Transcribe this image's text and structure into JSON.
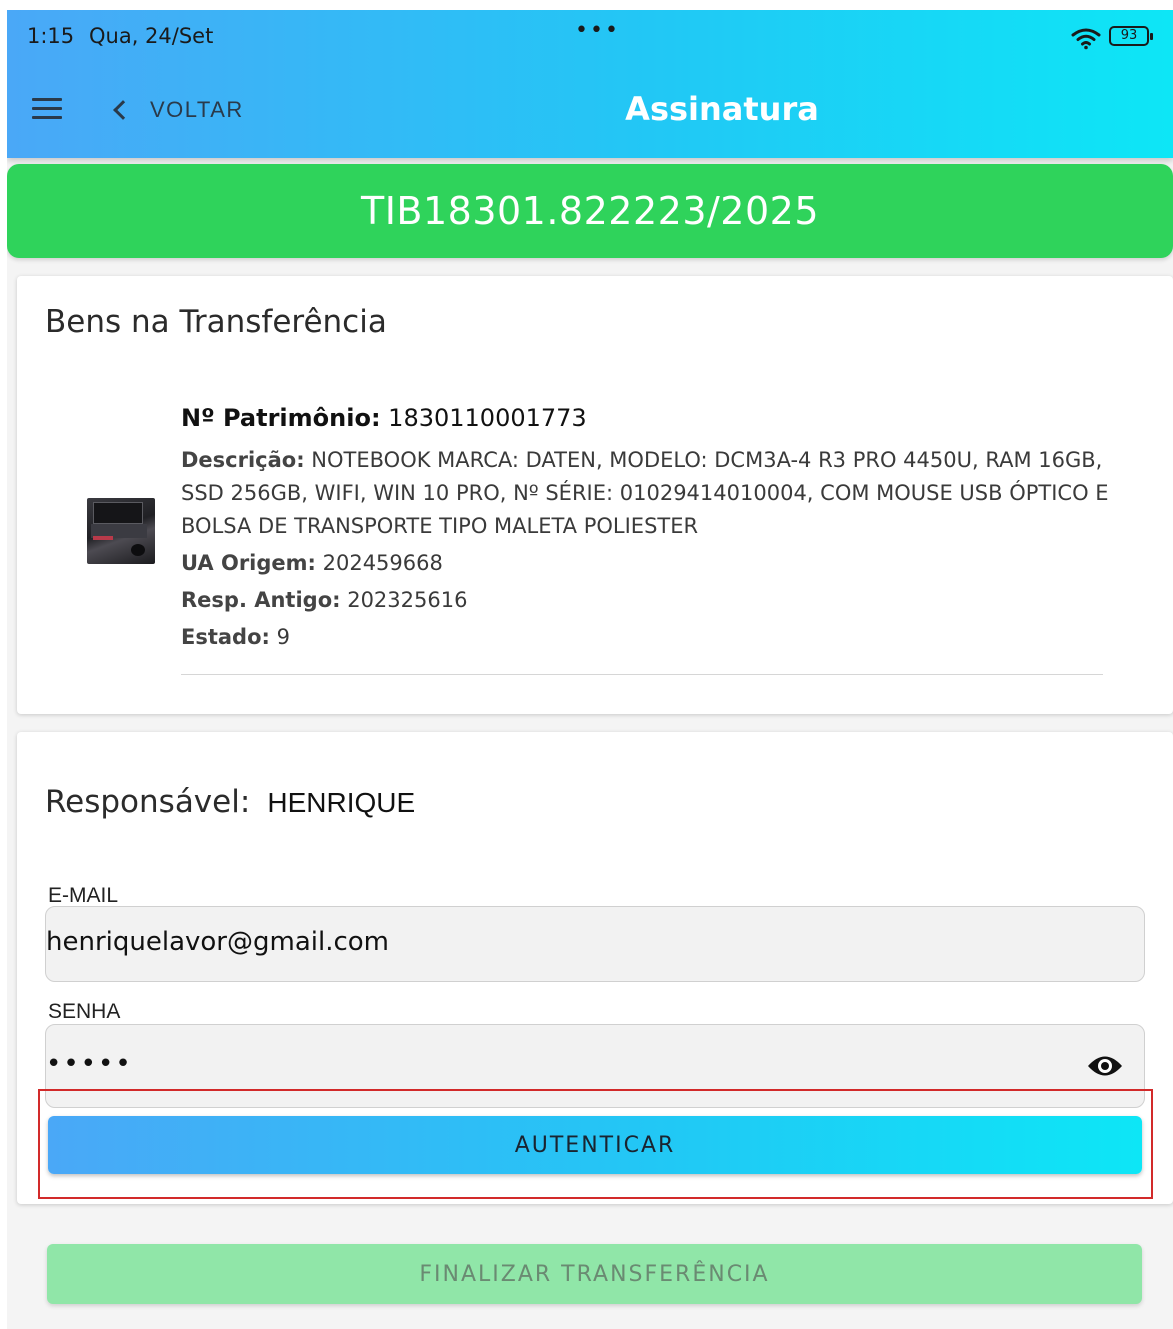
{
  "status_bar": {
    "time": "1:15",
    "date": "Qua, 24/Set",
    "dots": "•••",
    "battery": "93"
  },
  "header": {
    "back_label": "VOLTAR",
    "title": "Assinatura"
  },
  "banner": {
    "code": "TIB18301.822223/2025"
  },
  "items_card": {
    "title": "Bens na Transferência",
    "items": [
      {
        "patrimonio_label": "Nº Patrimônio:",
        "patrimonio_value": " 1830110001773",
        "descricao_label": "Descrição:",
        "descricao_value": " NOTEBOOK MARCA: DATEN, MODELO: DCM3A-4 R3 PRO 4450U, RAM 16GB, SSD 256GB, WIFI, WIN 10 PRO, Nº SÉRIE: 01029414010004, COM MOUSE USB ÓPTICO E BOLSA DE TRANSPORTE TIPO MALETA POLIESTER",
        "ua_label": "UA Origem:",
        "ua_value": " 202459668",
        "resp_label": "Resp. Antigo:",
        "resp_value": " 202325616",
        "estado_label": "Estado:",
        "estado_value": " 9"
      }
    ]
  },
  "auth_card": {
    "responsavel_label": "Responsável:",
    "responsavel_name": "HENRIQUE",
    "email_label": "E-MAIL",
    "email_value": "henriquelavor@gmail.com",
    "password_label": "SENHA",
    "password_value": "•••••",
    "auth_button": "AUTENTICAR"
  },
  "finalize_button": "FINALIZAR TRANSFERÊNCIA",
  "colors": {
    "header_gradient_start": "#4aa8f7",
    "header_gradient_end": "#0de6f6",
    "banner_green": "#2fd35b",
    "finalize_disabled": "#90e6a8",
    "highlight_red": "#d22a2a"
  }
}
